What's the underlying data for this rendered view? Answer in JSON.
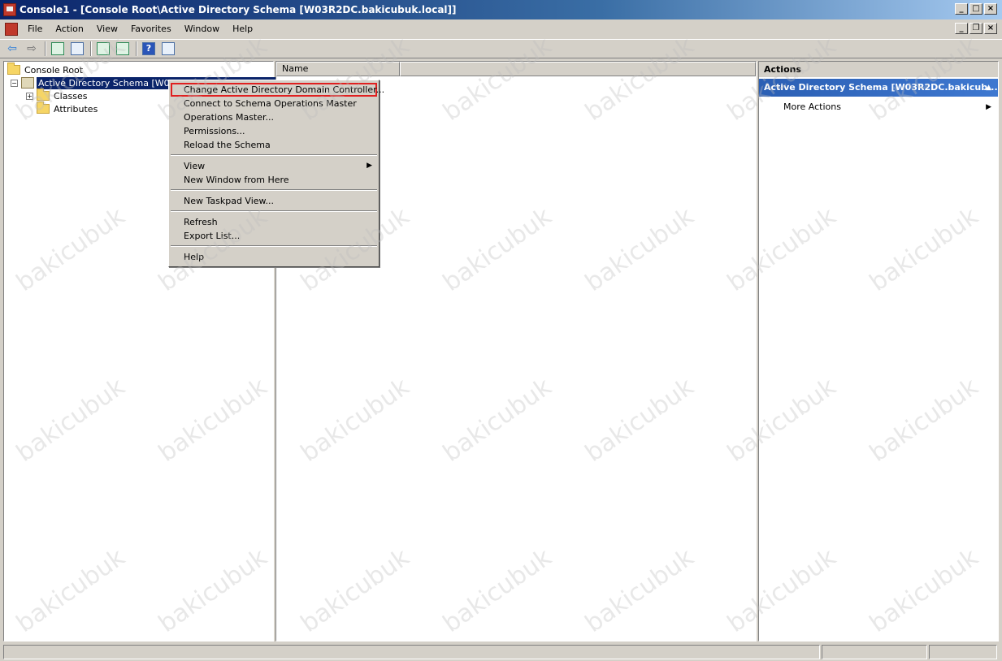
{
  "window": {
    "title": "Console1 - [Console Root\\Active Directory Schema [W03R2DC.bakicubuk.local]]",
    "min_glyph": "_",
    "max_glyph": "□",
    "close_glyph": "×",
    "restore_glyph": "❐"
  },
  "menubar": {
    "items": [
      "File",
      "Action",
      "View",
      "Favorites",
      "Window",
      "Help"
    ]
  },
  "toolbar": {
    "back_glyph": "⇦",
    "forward_glyph": "⇨",
    "help_glyph": "?"
  },
  "tree": {
    "root_label": "Console Root",
    "schema_label": "Active Directory Schema [W03R2DC.bakicubuk.local]",
    "collapse_glyph": "−",
    "expand_glyph": "+",
    "classes_label": "Classes",
    "attributes_label": "Attributes"
  },
  "list": {
    "columns": [
      "Name",
      ""
    ]
  },
  "actions": {
    "title": "Actions",
    "section_label": "Active Directory Schema [W03R2DC.bakicub...",
    "more_actions_label": "More Actions"
  },
  "context_menu": {
    "items": [
      "Change Active Directory Domain Controller...",
      "Connect to Schema Operations Master",
      "Operations Master...",
      "Permissions...",
      "Reload the Schema",
      "View",
      "New Window from Here",
      "New Taskpad View...",
      "Refresh",
      "Export List...",
      "Help"
    ],
    "highlighted_index": 0
  },
  "watermark": "bakicubuk",
  "colors": {
    "title_gradient_start": "#0a246a",
    "selection": "#0a246a",
    "actions_header": "#2b5fb4",
    "highlight_box": "#e02020"
  }
}
